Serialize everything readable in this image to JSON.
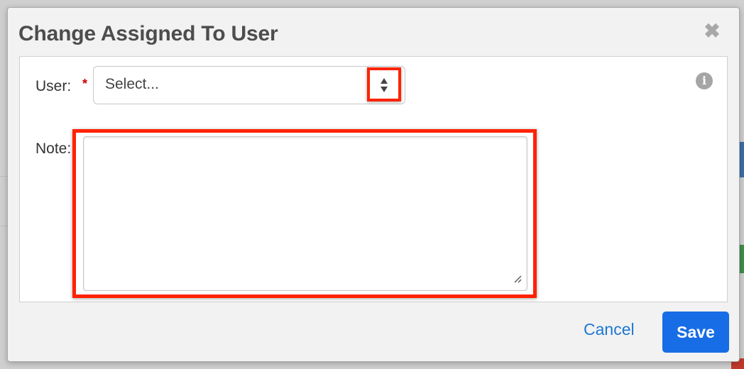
{
  "dialog": {
    "title": "Change Assigned To User",
    "close_icon": "close-icon",
    "info_icon": "info-icon"
  },
  "form": {
    "user_label": "User:",
    "required_marker": "*",
    "user_select_value": "Select...",
    "note_label": "Note:",
    "note_value": ""
  },
  "actions": {
    "cancel_label": "Cancel",
    "save_label": "Save"
  },
  "colors": {
    "highlight": "#ff2200",
    "primary_button": "#176de5",
    "link": "#1f78d1",
    "required": "#cc0000"
  }
}
